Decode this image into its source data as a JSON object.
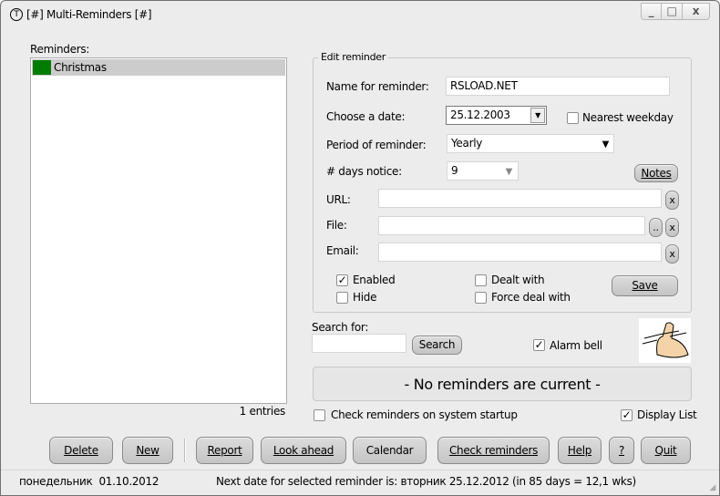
{
  "window": {
    "title": "[#] Multi-Reminders [#]",
    "minimize": "_",
    "maximize": "□",
    "close": "x"
  },
  "reminders": {
    "label": "Reminders:",
    "items": [
      {
        "name": "Christmas",
        "color": "#007d00"
      }
    ],
    "count": "1 entries"
  },
  "edit": {
    "legend": "Edit reminder",
    "name_label": "Name for reminder:",
    "name_value": "RSLOAD.NET",
    "date_label": "Choose a date:",
    "date_value": "25.12.2003",
    "nearest_weekday": "Nearest weekday",
    "period_label": "Period of reminder:",
    "period_value": "Yearly",
    "days_label": "# days notice:",
    "days_value": "9",
    "notes": "Notes",
    "url_label": "URL:",
    "url_value": "",
    "file_label": "File:",
    "file_value": "",
    "email_label": "Email:",
    "email_value": "",
    "clear": "x",
    "browse": "..",
    "enabled": "Enabled",
    "hide": "Hide",
    "dealt_with": "Dealt with",
    "force_deal_with": "Force deal with",
    "save": "Save"
  },
  "search": {
    "label": "Search for:",
    "value": "",
    "button": "Search"
  },
  "alarm_bell": "Alarm bell",
  "status_message": "- No reminders are current -",
  "startup": "Check reminders on system startup",
  "display_list": "Display List",
  "buttons": {
    "delete": "Delete",
    "new": "New",
    "report": "Report",
    "look_ahead": "Look ahead",
    "calendar": "Calendar",
    "check": "Check reminders",
    "help": "Help",
    "about": "?",
    "quit": "Quit"
  },
  "statusbar": {
    "date": "понедельник  01.10.2012",
    "next": "Next date for selected reminder is: вторник 25.12.2012 (in 85 days = 12,1 wks)"
  }
}
